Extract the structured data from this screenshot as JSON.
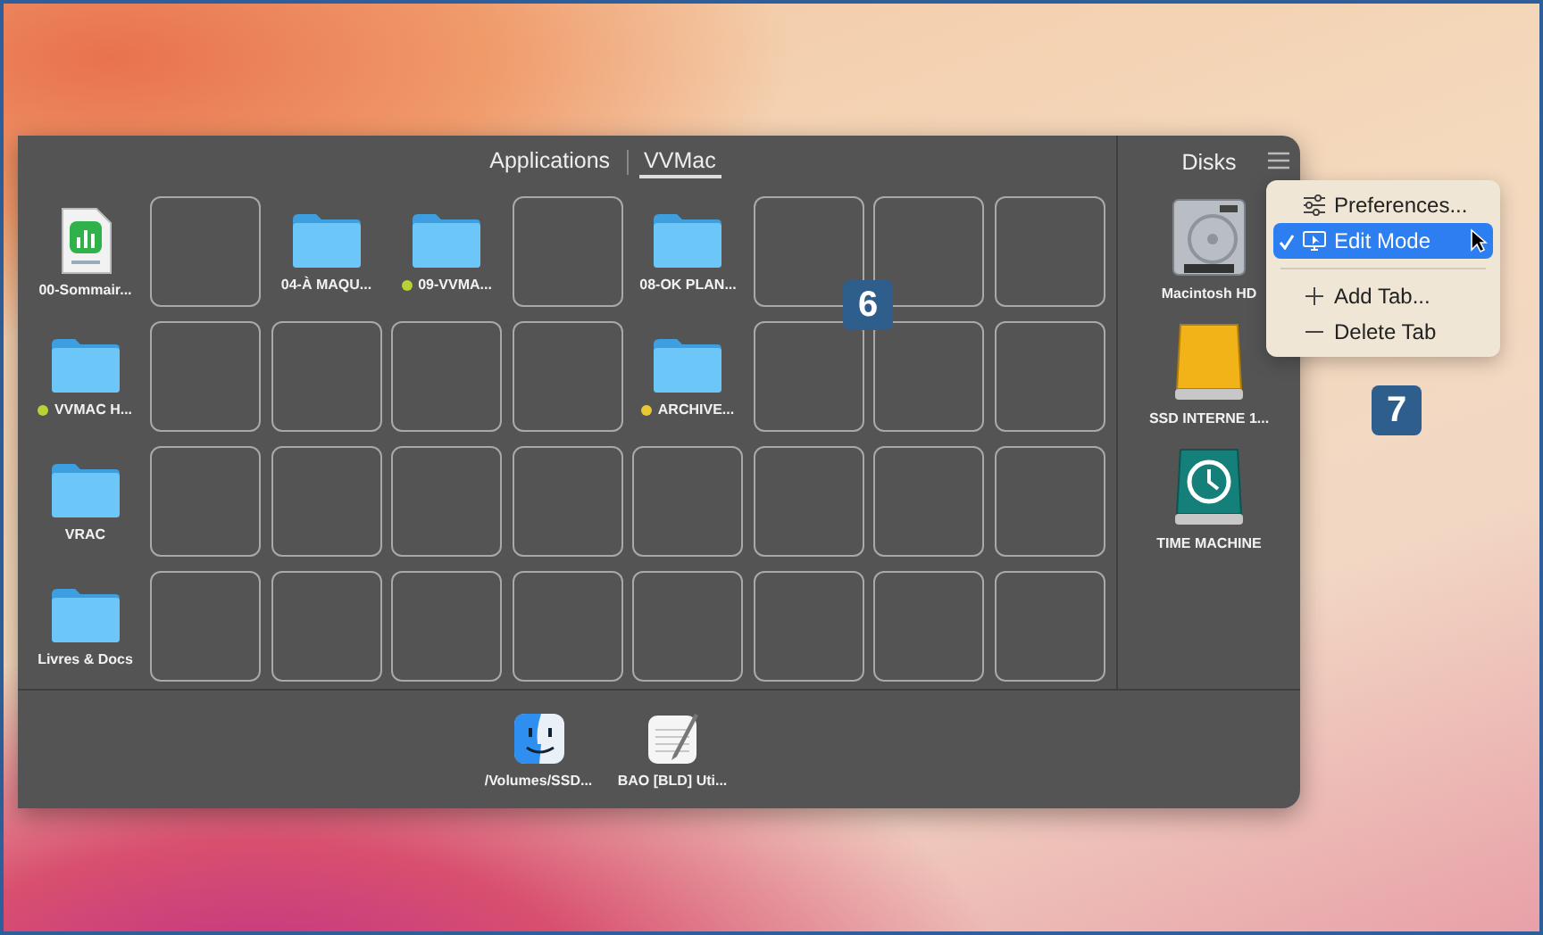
{
  "tabs": [
    {
      "label": "Applications",
      "selected": false
    },
    {
      "label": "VVMac",
      "selected": true
    }
  ],
  "grid": [
    [
      {
        "kind": "document",
        "label": "00-Sommair..."
      },
      {
        "kind": "empty"
      },
      {
        "kind": "folder",
        "label": "04-À MAQU..."
      },
      {
        "kind": "folder",
        "label": "09-VVMA...",
        "color": "#b5d334"
      },
      {
        "kind": "empty"
      },
      {
        "kind": "folder",
        "label": "08-OK PLAN..."
      },
      {
        "kind": "empty"
      },
      {
        "kind": "empty"
      },
      {
        "kind": "empty"
      }
    ],
    [
      {
        "kind": "folder",
        "label": "VVMAC H...",
        "color": "#b5d334"
      },
      {
        "kind": "empty"
      },
      {
        "kind": "empty"
      },
      {
        "kind": "empty"
      },
      {
        "kind": "empty"
      },
      {
        "kind": "folder",
        "label": "ARCHIVE...",
        "color": "#e8c935"
      },
      {
        "kind": "empty"
      },
      {
        "kind": "empty"
      },
      {
        "kind": "empty"
      }
    ],
    [
      {
        "kind": "folder",
        "label": "VRAC"
      },
      {
        "kind": "empty"
      },
      {
        "kind": "empty"
      },
      {
        "kind": "empty"
      },
      {
        "kind": "empty"
      },
      {
        "kind": "empty"
      },
      {
        "kind": "empty"
      },
      {
        "kind": "empty"
      },
      {
        "kind": "empty"
      }
    ],
    [
      {
        "kind": "folder",
        "label": "Livres & Docs"
      },
      {
        "kind": "empty"
      },
      {
        "kind": "empty"
      },
      {
        "kind": "empty"
      },
      {
        "kind": "empty"
      },
      {
        "kind": "empty"
      },
      {
        "kind": "empty"
      },
      {
        "kind": "empty"
      },
      {
        "kind": "empty"
      }
    ]
  ],
  "disks": {
    "title": "Disks",
    "items": [
      {
        "kind": "hard-disk",
        "label": "Macintosh HD"
      },
      {
        "kind": "external-disk",
        "label": "SSD INTERNE 1..."
      },
      {
        "kind": "time-machine",
        "label": "TIME MACHINE"
      }
    ]
  },
  "dock": [
    {
      "kind": "finder",
      "label": "/Volumes/SSD..."
    },
    {
      "kind": "text-editor",
      "label": "BAO [BLD] Uti..."
    }
  ],
  "menu": [
    {
      "kind": "preferences",
      "label": "Preferences...",
      "checked": false,
      "selected": false
    },
    {
      "kind": "mode",
      "label": "Edit Mode",
      "checked": true,
      "selected": true
    },
    {
      "kind": "separator"
    },
    {
      "kind": "add",
      "label": "Add Tab...",
      "checked": false,
      "selected": false
    },
    {
      "kind": "delete",
      "label": "Delete Tab",
      "checked": false,
      "selected": false
    }
  ],
  "callouts": [
    "6",
    "7"
  ]
}
